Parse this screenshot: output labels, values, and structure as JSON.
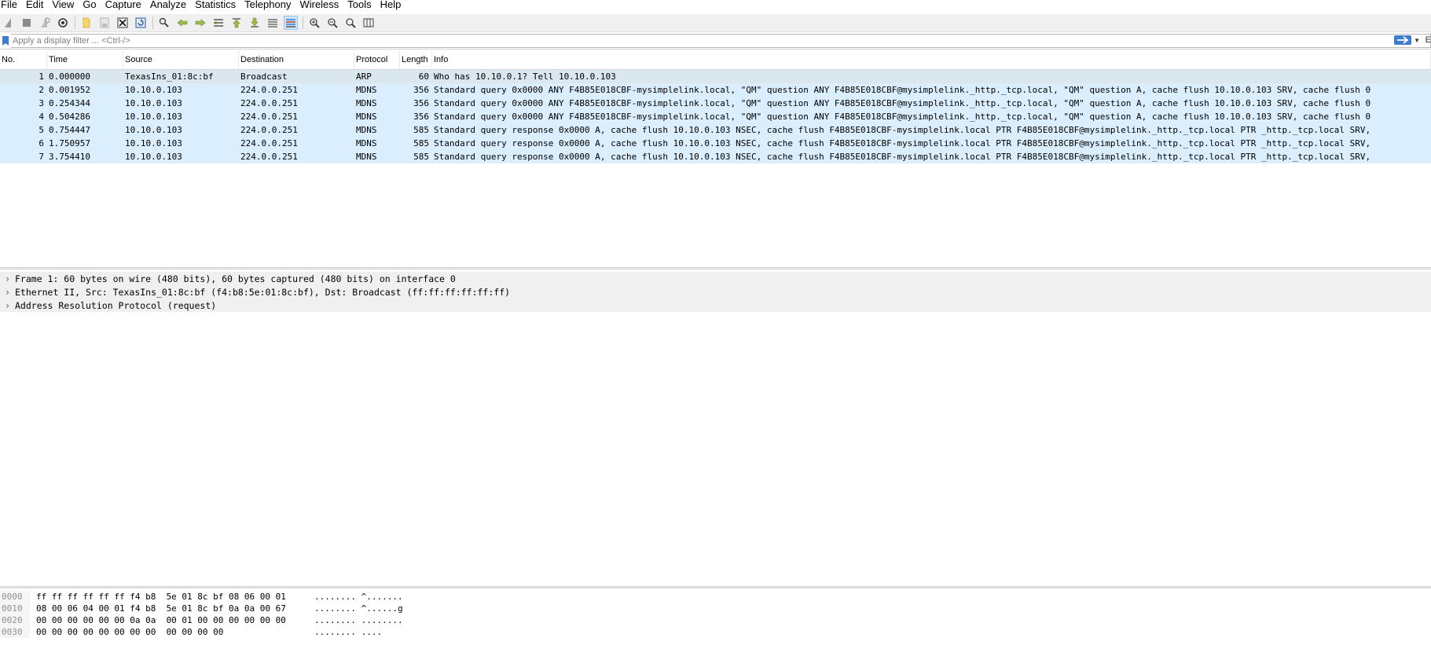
{
  "menu": [
    "File",
    "Edit",
    "View",
    "Go",
    "Capture",
    "Analyze",
    "Statistics",
    "Telephony",
    "Wireless",
    "Tools",
    "Help"
  ],
  "filter": {
    "placeholder": "Apply a display filter ... <Ctrl-/>",
    "expression_label": "E"
  },
  "packet_list": {
    "columns": [
      "No.",
      "Time",
      "Source",
      "Destination",
      "Protocol",
      "Length",
      "Info"
    ],
    "rows": [
      {
        "no": "1",
        "time": "0.000000",
        "src": "TexasIns_01:8c:bf",
        "dst": "Broadcast",
        "proto": "ARP",
        "len": "60",
        "info": "Who has 10.10.0.1? Tell 10.10.0.103"
      },
      {
        "no": "2",
        "time": "0.001952",
        "src": "10.10.0.103",
        "dst": "224.0.0.251",
        "proto": "MDNS",
        "len": "356",
        "info": "Standard query 0x0000 ANY F4B85E018CBF-mysimplelink.local, \"QM\" question ANY F4B85E018CBF@mysimplelink._http._tcp.local, \"QM\" question A, cache flush 10.10.0.103 SRV, cache flush 0"
      },
      {
        "no": "3",
        "time": "0.254344",
        "src": "10.10.0.103",
        "dst": "224.0.0.251",
        "proto": "MDNS",
        "len": "356",
        "info": "Standard query 0x0000 ANY F4B85E018CBF-mysimplelink.local, \"QM\" question ANY F4B85E018CBF@mysimplelink._http._tcp.local, \"QM\" question A, cache flush 10.10.0.103 SRV, cache flush 0"
      },
      {
        "no": "4",
        "time": "0.504286",
        "src": "10.10.0.103",
        "dst": "224.0.0.251",
        "proto": "MDNS",
        "len": "356",
        "info": "Standard query 0x0000 ANY F4B85E018CBF-mysimplelink.local, \"QM\" question ANY F4B85E018CBF@mysimplelink._http._tcp.local, \"QM\" question A, cache flush 10.10.0.103 SRV, cache flush 0"
      },
      {
        "no": "5",
        "time": "0.754447",
        "src": "10.10.0.103",
        "dst": "224.0.0.251",
        "proto": "MDNS",
        "len": "585",
        "info": "Standard query response 0x0000 A, cache flush 10.10.0.103 NSEC, cache flush F4B85E018CBF-mysimplelink.local PTR F4B85E018CBF@mysimplelink._http._tcp.local PTR _http._tcp.local SRV,"
      },
      {
        "no": "6",
        "time": "1.750957",
        "src": "10.10.0.103",
        "dst": "224.0.0.251",
        "proto": "MDNS",
        "len": "585",
        "info": "Standard query response 0x0000 A, cache flush 10.10.0.103 NSEC, cache flush F4B85E018CBF-mysimplelink.local PTR F4B85E018CBF@mysimplelink._http._tcp.local PTR _http._tcp.local SRV,"
      },
      {
        "no": "7",
        "time": "3.754410",
        "src": "10.10.0.103",
        "dst": "224.0.0.251",
        "proto": "MDNS",
        "len": "585",
        "info": "Standard query response 0x0000 A, cache flush 10.10.0.103 NSEC, cache flush F4B85E018CBF-mysimplelink.local PTR F4B85E018CBF@mysimplelink._http._tcp.local PTR _http._tcp.local SRV,"
      }
    ]
  },
  "details": [
    "Frame 1: 60 bytes on wire (480 bits), 60 bytes captured (480 bits) on interface 0",
    "Ethernet II, Src: TexasIns_01:8c:bf (f4:b8:5e:01:8c:bf), Dst: Broadcast (ff:ff:ff:ff:ff:ff)",
    "Address Resolution Protocol (request)"
  ],
  "bytes": [
    {
      "offset": "0000",
      "hex": "ff ff ff ff ff ff f4 b8  5e 01 8c bf 08 06 00 01",
      "ascii": "........ ^......."
    },
    {
      "offset": "0010",
      "hex": "08 00 06 04 00 01 f4 b8  5e 01 8c bf 0a 0a 00 67",
      "ascii": "........ ^......g"
    },
    {
      "offset": "0020",
      "hex": "00 00 00 00 00 00 0a 0a  00 01 00 00 00 00 00 00",
      "ascii": "........ ........"
    },
    {
      "offset": "0030",
      "hex": "00 00 00 00 00 00 00 00  00 00 00 00",
      "ascii": "........ ...."
    }
  ],
  "colors": {
    "arp_row": "#c8d8e0",
    "mdns_row": "#daeefd",
    "details_bg": "#f0f0f0",
    "apply_button": "#3d7cd2"
  },
  "toolbar_icons": [
    "shark-fin-start-icon",
    "stop-icon",
    "restart-icon",
    "capture-options-icon",
    "open-file-icon",
    "save-file-icon",
    "close-file-icon",
    "reload-icon",
    "find-packet-icon",
    "go-back-icon",
    "go-forward-icon",
    "go-to-packet-icon",
    "first-packet-icon",
    "last-packet-icon",
    "autoscroll-icon",
    "colorize-icon",
    "zoom-in-icon",
    "zoom-out-icon",
    "zoom-normal-icon",
    "resize-columns-icon"
  ]
}
